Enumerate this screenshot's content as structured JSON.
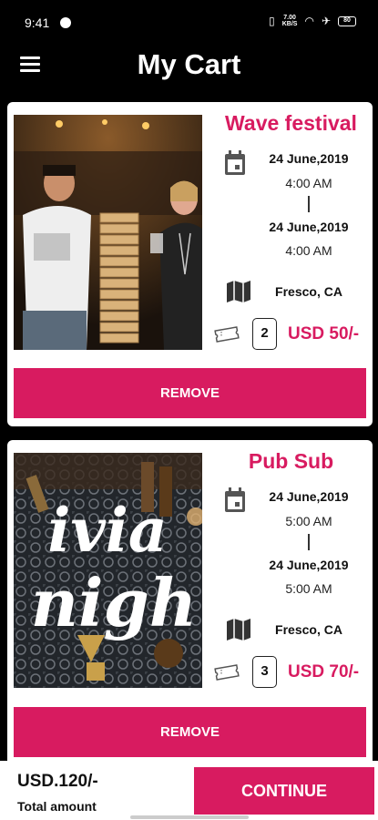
{
  "status_bar": {
    "time": "9:41",
    "network_speed": "7.00",
    "network_unit": "KB/S",
    "battery": "80",
    "icons": [
      "app-notification-icon",
      "vibrate-icon",
      "wifi-icon",
      "signal-icon",
      "battery-icon"
    ]
  },
  "header": {
    "title": "My Cart",
    "menu_icon": "hamburger-menu-icon"
  },
  "cart_items": [
    {
      "name": "Wave festival",
      "start_date": "24 June,2019",
      "start_time": "4:00 AM",
      "end_date": "24 June,2019",
      "end_time": "4:00 AM",
      "location": "Fresco, CA",
      "quantity": "2",
      "price": "USD 50/-",
      "remove_label": "REMOVE",
      "image": "people-playing-jenga-photo"
    },
    {
      "name": "Pub Sub",
      "start_date": "24 June,2019",
      "start_time": "5:00 AM",
      "end_date": "24 June,2019",
      "end_time": "5:00 AM",
      "location": "Fresco, CA",
      "quantity": "3",
      "price": "USD 70/-",
      "remove_label": "REMOVE",
      "image": "trivia-night-poster",
      "image_text_1": "ivia",
      "image_text_2": "nigh"
    }
  ],
  "footer": {
    "total": "USD.120/-",
    "total_label": "Total amount",
    "continue_label": "CONTINUE"
  },
  "colors": {
    "accent": "#d81b60",
    "background": "#000000",
    "card": "#ffffff"
  }
}
